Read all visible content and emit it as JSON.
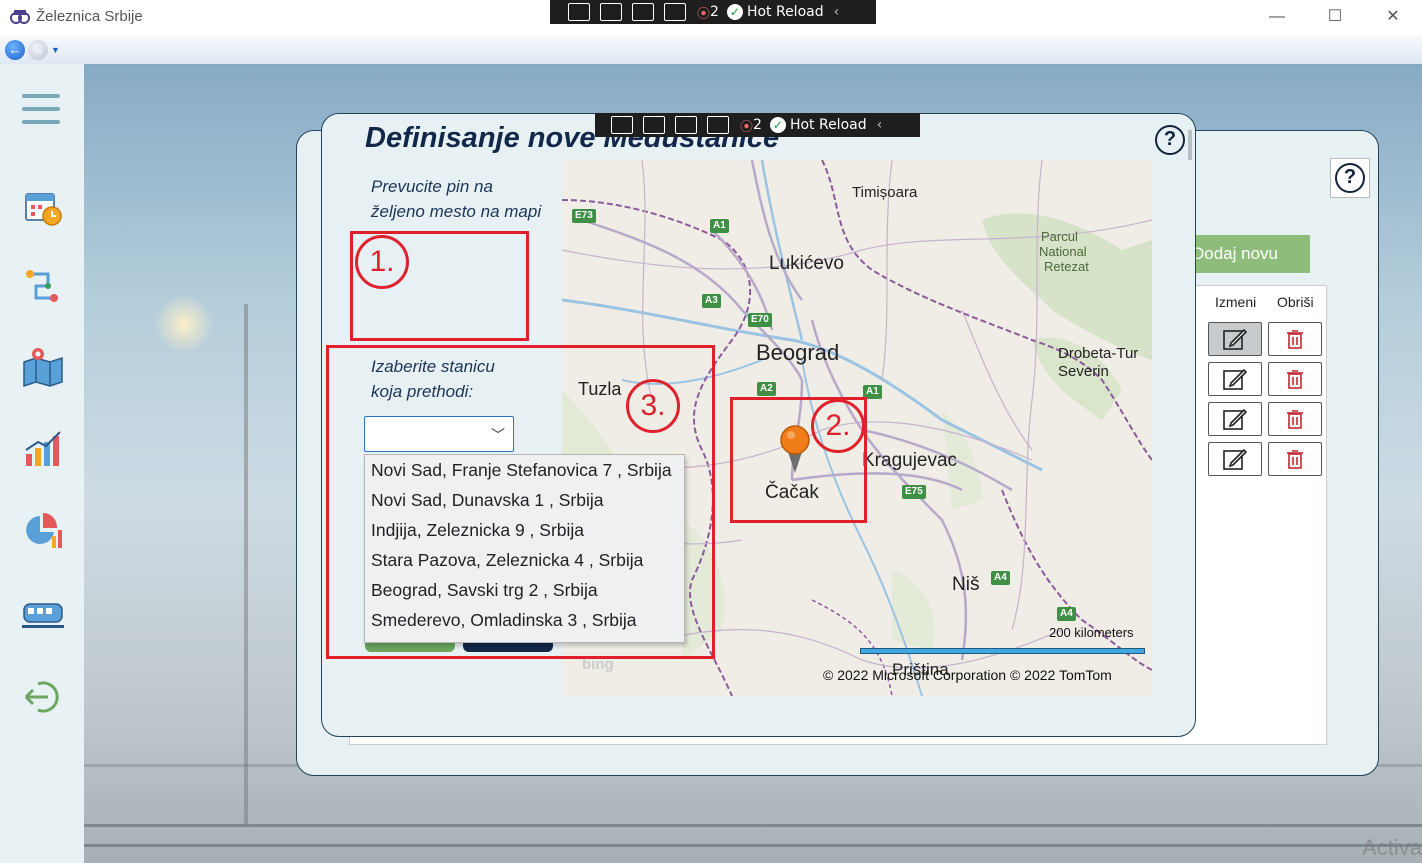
{
  "window": {
    "title": "Železnica Srbije",
    "controls": [
      "—",
      "☐",
      "✕"
    ]
  },
  "debug_toolbar": {
    "count": "2",
    "hot_reload_label": "Hot Reload"
  },
  "background_panel": {
    "add_line_label": "Dodaj novu liniju",
    "columns": [
      "Izmeni",
      "Obriši"
    ],
    "rows": 4
  },
  "dialog": {
    "title": "Definisanje nove Međustanice",
    "pin_instruction_line1": "Prevucite pin na",
    "pin_instruction_line2": "željeno mesto na mapi",
    "station_label_line1": "Izaberite stanicu",
    "station_label_line2": "koja prethodi:",
    "selected_station": "",
    "station_options": [
      "Novi Sad, Franje Stefanovica 7 , Srbija",
      "Novi Sad, Dunavska 1 , Srbija",
      "Indjija, Zeleznicka 9 , Srbija",
      "Stara Pazova, Zeleznicka 4 , Srbija",
      "Beograd, Savski trg 2 , Srbija",
      "Smederevo, Omladinska 3 , Srbija"
    ]
  },
  "map": {
    "cities": {
      "timisoara": "Timișoara",
      "lukicevo": "Lukićevo",
      "beograd": "Beograd",
      "tuzla": "Tuzla",
      "kragujevac": "Kragujevac",
      "cacak": "Čačak",
      "nis": "Niš",
      "drobeta": "Drobeta-Tur",
      "severin": "Severin",
      "retezat1": "Parcul",
      "retezat2": "National",
      "retezat3": "Retezat",
      "pristina": "Priština"
    },
    "roads": [
      "E73",
      "A1",
      "A3",
      "E70",
      "A2",
      "A1",
      "E75",
      "A4",
      "A4"
    ],
    "scale_label": "200 kilometers",
    "copyright": "© 2022 Microsoft Corporation   © 2022 TomTom",
    "provider": "bing"
  },
  "annotations": [
    "1.",
    "2.",
    "3."
  ],
  "watermark": "Activa"
}
